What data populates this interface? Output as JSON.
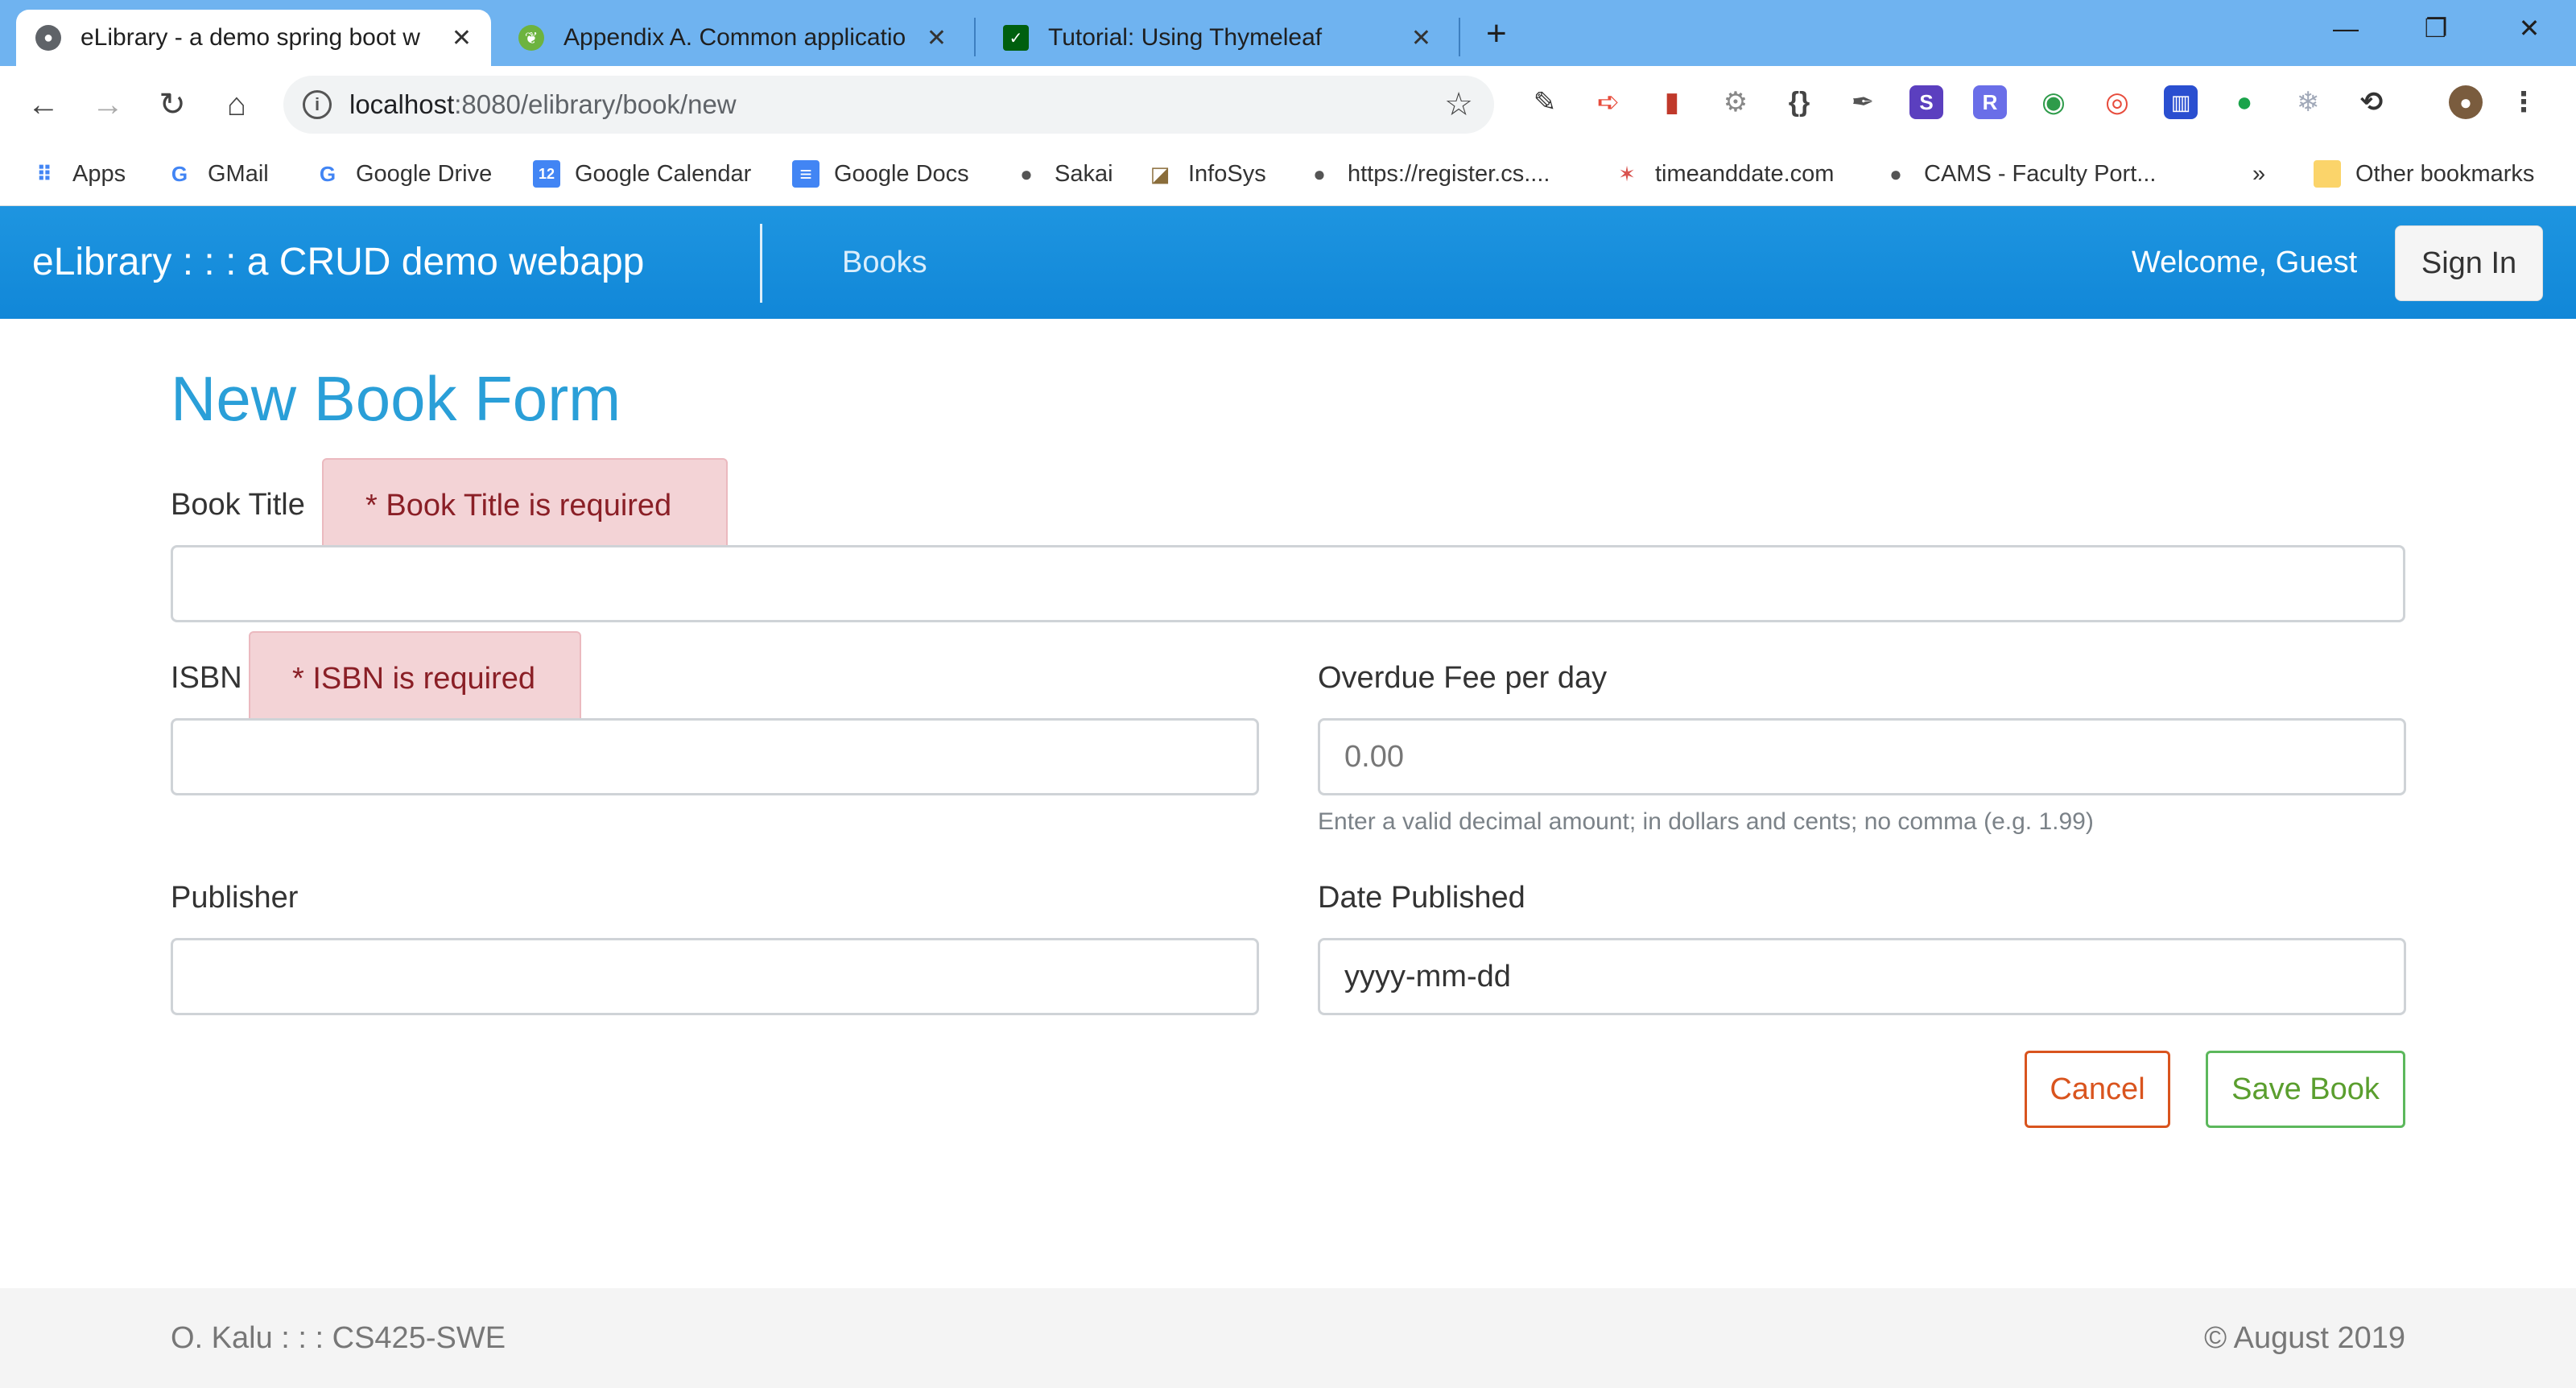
{
  "browser": {
    "tabs": [
      {
        "title": "eLibrary - a demo spring boot w",
        "active": true,
        "favicon": "globe-icon"
      },
      {
        "title": "Appendix A. Common applicatio",
        "active": false,
        "favicon": "spring-leaf-icon"
      },
      {
        "title": "Tutorial: Using Thymeleaf",
        "active": false,
        "favicon": "thymeleaf-icon"
      }
    ],
    "new_tab_label": "+",
    "window_controls": {
      "minimize": "—",
      "restore": "❐",
      "close": "✕"
    },
    "address": {
      "host": "localhost",
      "path": ":8080/elibrary/book/new"
    },
    "extensions": [
      {
        "name": "colorpick-icon",
        "glyph": "✎",
        "color": "#333333"
      },
      {
        "name": "arrow-ext-icon",
        "glyph": "➪",
        "color": "#e74c3c"
      },
      {
        "name": "pdf-ext-icon",
        "glyph": "▮",
        "color": "#c0392b"
      },
      {
        "name": "gear-ext-icon",
        "glyph": "⚙",
        "color": "#888888"
      },
      {
        "name": "json-ext-icon",
        "glyph": "{}",
        "color": "#444444"
      },
      {
        "name": "eyedropper-icon",
        "glyph": "✒",
        "color": "#555555"
      },
      {
        "name": "s-ext-icon",
        "glyph": "S",
        "color": "#5b3fbf"
      },
      {
        "name": "r-ext-icon",
        "glyph": "R",
        "color": "#6a6ee8"
      },
      {
        "name": "search-ext-icon",
        "glyph": "◉",
        "color": "#2e9b4a"
      },
      {
        "name": "color-wheel-icon",
        "glyph": "◎",
        "color": "#e74c3c"
      },
      {
        "name": "ruler-ext-icon",
        "glyph": "▥",
        "color": "#2a4fd0"
      },
      {
        "name": "chat-bubble-icon",
        "glyph": "●",
        "color": "#1aa34a"
      },
      {
        "name": "snowflake-ext-icon",
        "glyph": "❄",
        "color": "#a0a8b8"
      },
      {
        "name": "sync-ext-icon",
        "glyph": "⟲",
        "color": "#333333"
      }
    ],
    "bookmarks": [
      {
        "label": "Apps",
        "icon": "apps-grid-icon",
        "glyph": "⠿",
        "color": "#4285f4"
      },
      {
        "label": "GMail",
        "icon": "google-g-icon",
        "glyph": "G",
        "color": "#4285f4"
      },
      {
        "label": "Google Drive",
        "icon": "google-g-icon",
        "glyph": "G",
        "color": "#4285f4"
      },
      {
        "label": "Google Calendar",
        "icon": "calendar-icon",
        "glyph": "12",
        "color": "#4285f4"
      },
      {
        "label": "Google Docs",
        "icon": "docs-icon",
        "glyph": "≡",
        "color": "#4285f4"
      },
      {
        "label": "Sakai",
        "icon": "globe-icon",
        "glyph": "●",
        "color": "#555555"
      },
      {
        "label": "InfoSys",
        "icon": "infosys-icon",
        "glyph": "◪",
        "color": "#8a6d3b"
      },
      {
        "label": "https://register.cs....",
        "icon": "globe-icon",
        "glyph": "●",
        "color": "#555555"
      },
      {
        "label": "timeanddate.com",
        "icon": "timeanddate-icon",
        "glyph": "✶",
        "color": "#d9534f"
      },
      {
        "label": "CAMS - Faculty Port...",
        "icon": "globe-icon",
        "glyph": "●",
        "color": "#555555"
      }
    ],
    "bookmarks_overflow": "»",
    "other_bookmarks": "Other bookmarks"
  },
  "navbar": {
    "brand": "eLibrary : : : a CRUD demo webapp",
    "links": [
      "Books"
    ],
    "welcome": "Welcome, Guest",
    "signin": "Sign In"
  },
  "form": {
    "title": "New Book Form",
    "book_title": {
      "label": "Book Title",
      "error": "* Book Title is required",
      "value": ""
    },
    "isbn": {
      "label": "ISBN",
      "error": "* ISBN is required",
      "value": ""
    },
    "overdue_fee": {
      "label": "Overdue Fee per day",
      "placeholder": "0.00",
      "help": "Enter a valid decimal amount; in dollars and cents; no comma (e.g. 1.99)"
    },
    "publisher": {
      "label": "Publisher",
      "value": ""
    },
    "date_published": {
      "label": "Date Published",
      "placeholder": "yyyy-mm-dd"
    },
    "cancel": "Cancel",
    "save": "Save Book"
  },
  "footer": {
    "left": "O. Kalu : : : CS425-SWE",
    "right": "© August 2019"
  },
  "colors": {
    "browser_frame": "#6fb3f0",
    "navbar": "#1187d8",
    "title": "#2a9fd8",
    "error_bg": "#f3d3d6",
    "error_text": "#8a1f26",
    "cancel": "#d9541e",
    "save": "#5cb85c"
  }
}
